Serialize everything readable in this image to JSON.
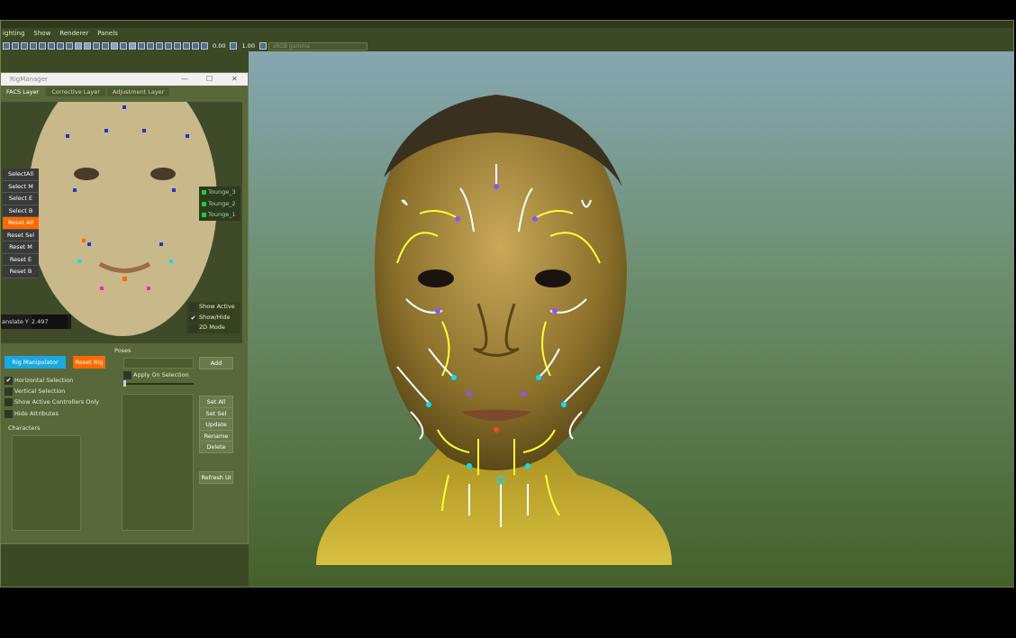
{
  "menu": [
    "ighting",
    "Show",
    "Renderer",
    "Panels"
  ],
  "toolbar": {
    "value1": "0.00",
    "value2": "1.00",
    "color_mode": "sRGB gamma"
  },
  "rig_manager": {
    "title": "RigManager",
    "window_controls": [
      "—",
      "☐",
      "✕"
    ],
    "tabs": [
      "FACS Layer",
      "Corrective Layer",
      "Adjustment Layer"
    ],
    "select_menu": [
      "SelectAll",
      "Select M",
      "Select E",
      "Select B",
      "Reset All",
      "Reset Sel",
      "Reset M",
      "Reset E",
      "Reset B"
    ],
    "tounge_items": [
      "Tounge_3",
      "Tounge_2",
      "Tounge_1"
    ],
    "show_options": [
      {
        "label": "Show Active",
        "checked": false
      },
      {
        "label": "Show/Hide",
        "checked": true
      },
      {
        "label": "2D Mode",
        "checked": false
      }
    ],
    "translate_label": "anslate Y",
    "translate_value": "2.497",
    "rig_manipulator_label": "Rig Manipulator",
    "reset_rig_label": "Reset Rig",
    "options": [
      {
        "label": "Horizontal Selection",
        "checked": true
      },
      {
        "label": "Vertical Selection",
        "checked": false
      },
      {
        "label": "Show Active Controllers Only",
        "checked": false
      },
      {
        "label": "Hide Attributes",
        "checked": false
      }
    ],
    "characters_label": "Characters",
    "poses_label": "Poses",
    "add_label": "Add",
    "apply_on_selection_label": "Apply On Selection",
    "pose_buttons": [
      "Set All",
      "Set Sel",
      "Update",
      "Rename",
      "Delete"
    ],
    "refresh_label": "Refresh UI"
  },
  "colors": {
    "accent_cyan": "#1aa8e0",
    "accent_orange": "#ff6a00",
    "panel_bg": "#58683a",
    "viewport_sky": "#86a7b1",
    "viewport_ground": "#44602a",
    "skin": "#b89a3a"
  }
}
